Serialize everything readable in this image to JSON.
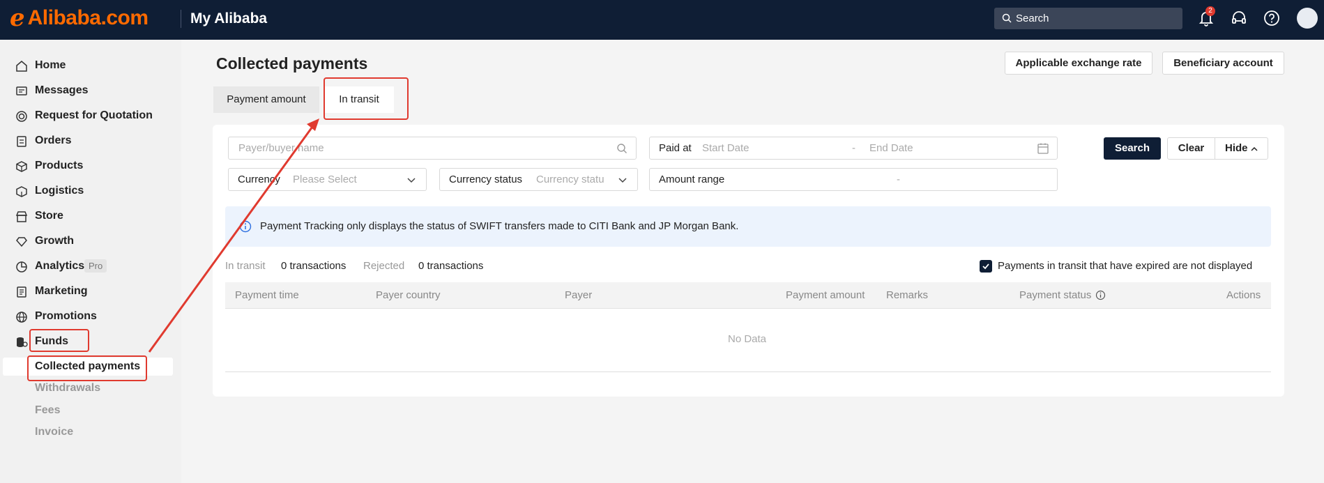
{
  "header": {
    "logo_mark": "ℯ",
    "logo_text": "Alibaba.com",
    "title": "My Alibaba",
    "search_placeholder": "Search",
    "notification_count": "2",
    "icons": [
      "bell-icon",
      "headset-icon",
      "help-icon",
      "avatar"
    ]
  },
  "sidebar": {
    "items": [
      {
        "label": "Home",
        "icon": "home-icon"
      },
      {
        "label": "Messages",
        "icon": "messages-icon"
      },
      {
        "label": "Request for Quotation",
        "icon": "target-icon"
      },
      {
        "label": "Orders",
        "icon": "clipboard-icon"
      },
      {
        "label": "Products",
        "icon": "box-icon"
      },
      {
        "label": "Logistics",
        "icon": "cube-icon"
      },
      {
        "label": "Store",
        "icon": "store-icon"
      },
      {
        "label": "Growth",
        "icon": "diamond-icon"
      },
      {
        "label": "Analytics",
        "icon": "pie-icon",
        "badge": "Pro"
      },
      {
        "label": "Marketing",
        "icon": "document-icon"
      },
      {
        "label": "Promotions",
        "icon": "globe-icon"
      },
      {
        "label": "Funds",
        "icon": "coins-icon"
      }
    ],
    "funds_subitems": [
      "Collected payments",
      "Withdrawals",
      "Fees",
      "Invoice"
    ]
  },
  "main": {
    "title": "Collected payments",
    "exchange_rate_button": "Applicable exchange rate",
    "beneficiary_button": "Beneficiary account",
    "tabs": [
      "Payment amount",
      "In transit"
    ],
    "filters": {
      "payer_placeholder": "Payer/buyer name",
      "paid_at_label": "Paid at",
      "start_date_placeholder": "Start Date",
      "date_separator": "-",
      "end_date_placeholder": "End Date",
      "currency_label": "Currency",
      "currency_placeholder": "Please Select",
      "currency_status_label": "Currency status",
      "currency_status_placeholder": "Currency statu",
      "amount_range_label": "Amount range",
      "amount_separator": "-",
      "search_button": "Search",
      "clear_button": "Clear",
      "hide_button": "Hide"
    },
    "notice": "Payment Tracking only displays the status of SWIFT transfers made to CITI Bank and JP Morgan Bank.",
    "stats": {
      "in_transit_label": "In transit",
      "in_transit_value": "0 transactions",
      "rejected_label": "Rejected",
      "rejected_value": "0 transactions"
    },
    "expired_checkbox_label": "Payments in transit that have expired are not displayed",
    "expired_checkbox_checked": true,
    "table": {
      "columns": [
        "Payment time",
        "Payer country",
        "Payer",
        "Payment amount",
        "Remarks",
        "Payment status",
        "Actions"
      ],
      "empty_text": "No Data"
    }
  },
  "colors": {
    "topbar": "#0f1e35",
    "brand": "#ff6a00",
    "annotation": "#e03a2f",
    "primary_button": "#0f1e35"
  }
}
